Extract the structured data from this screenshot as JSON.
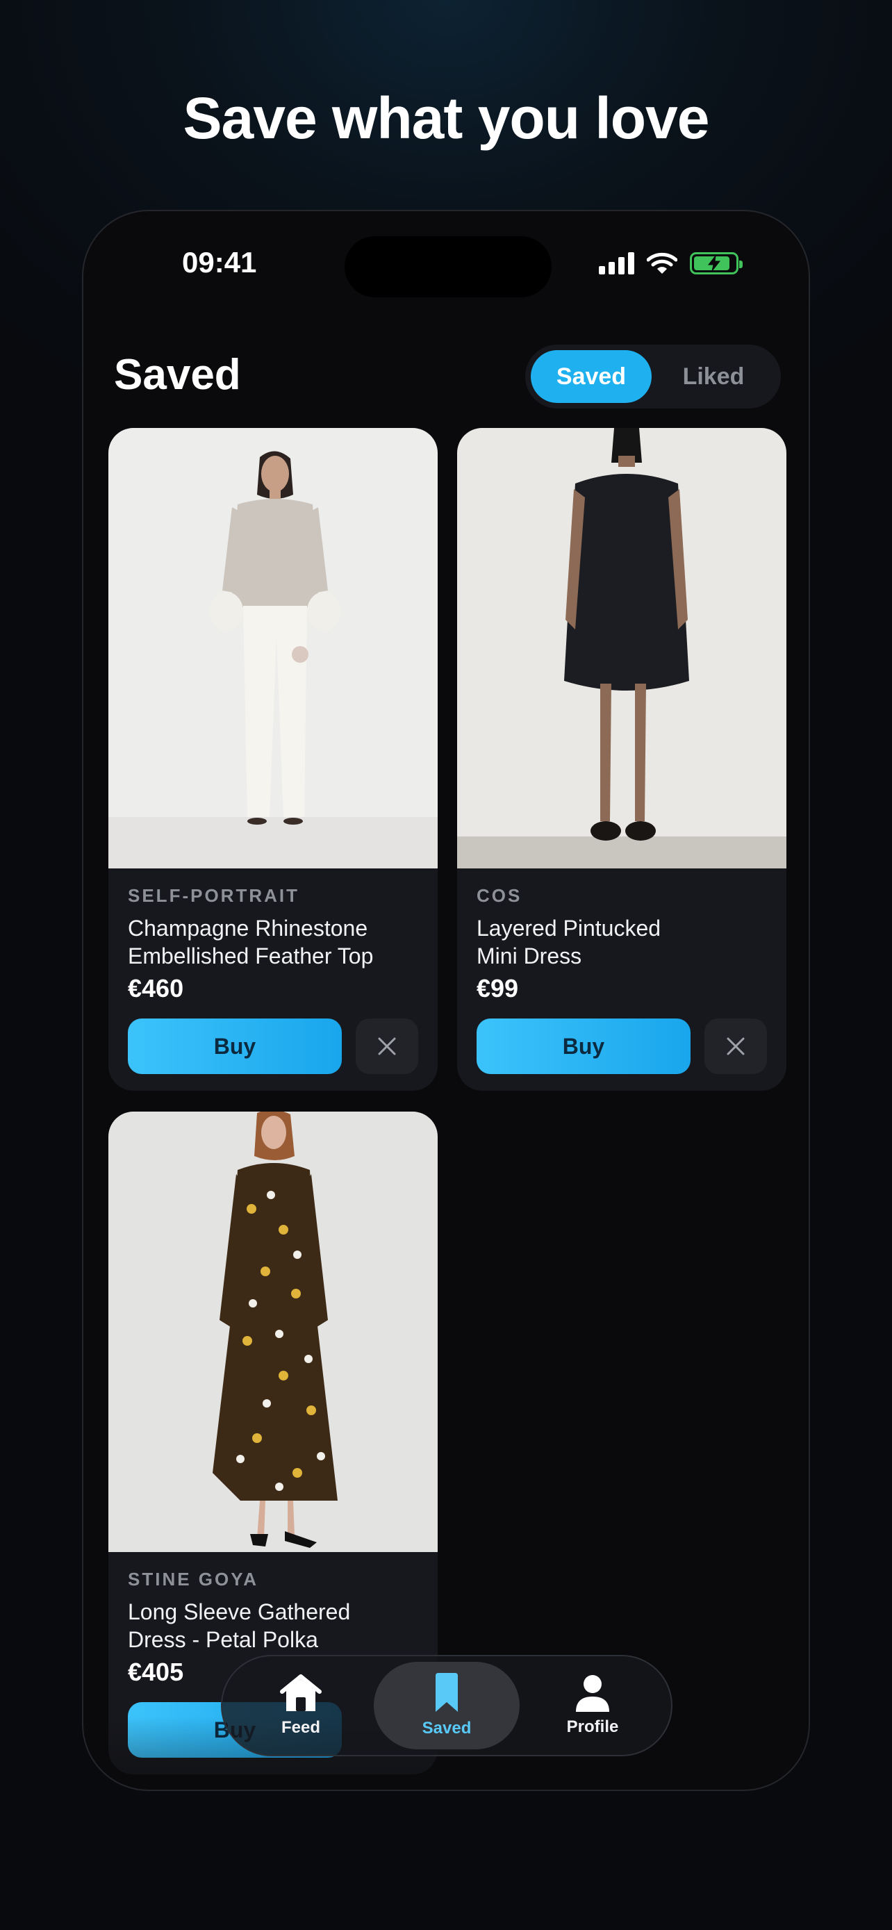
{
  "headline": "Save what you love",
  "status_bar": {
    "time": "09:41"
  },
  "page": {
    "title": "Saved"
  },
  "segments": {
    "active": "Saved",
    "inactive": "Liked"
  },
  "products": [
    {
      "brand": "SELF-PORTRAIT",
      "name_line1": "Champagne Rhinestone",
      "name_line2": "Embellished Feather Top",
      "price": "€460",
      "buy_label": "Buy"
    },
    {
      "brand": "COS",
      "name_line1": "Layered Pintucked",
      "name_line2": "Mini Dress",
      "price": "€99",
      "buy_label": "Buy"
    },
    {
      "brand": "STINE GOYA",
      "name_line1": "Long Sleeve Gathered",
      "name_line2": "Dress - Petal Polka",
      "price": "€405",
      "buy_label": "Buy"
    }
  ],
  "tabbar": {
    "feed": "Feed",
    "saved": "Saved",
    "profile": "Profile"
  },
  "colors": {
    "accent": "#1fb0f0",
    "battery": "#3fc35a",
    "background": "#0a0a0d"
  },
  "icons": [
    "signal-icon",
    "wifi-icon",
    "battery-charging-icon",
    "close-icon",
    "home-icon",
    "bookmark-icon",
    "person-icon"
  ]
}
